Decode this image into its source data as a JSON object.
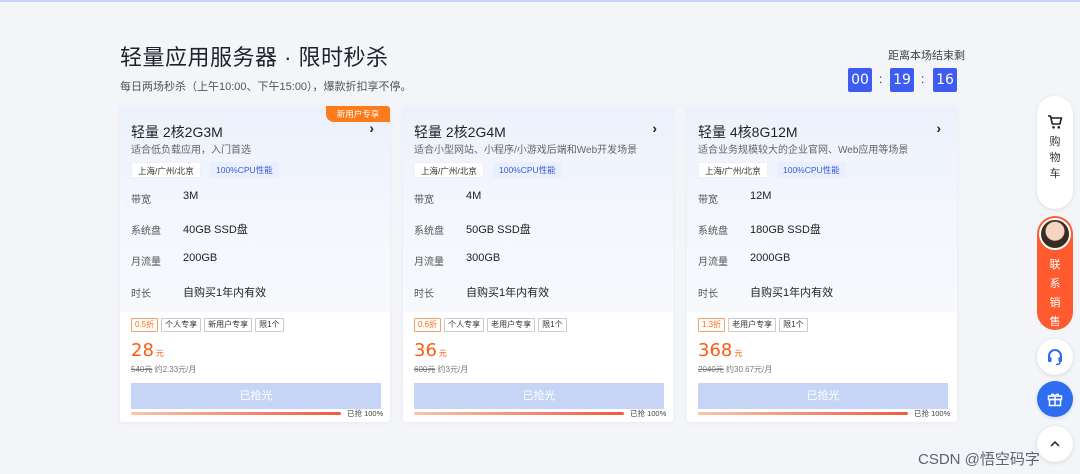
{
  "header": {
    "title": "轻量应用服务器 · 限时秒杀",
    "subtitle": "每日两场秒杀（上午10:00、下午15:00），爆款折扣享不停。"
  },
  "countdown": {
    "label": "距离本场结束剩",
    "hours": "00",
    "minutes": "19",
    "seconds": "16",
    "separator": ":"
  },
  "spec_labels": {
    "bandwidth": "带宽",
    "disk": "系统盘",
    "traffic": "月流量",
    "duration": "时长"
  },
  "cards": [
    {
      "badge": "新用户专享",
      "title": "轻量 2核2G3M",
      "desc": "适合低负载应用，入门首选",
      "region": "上海/广州/北京",
      "cpu_tag": "100%CPU性能",
      "bandwidth": "3M",
      "disk": "40GB SSD盘",
      "traffic": "200GB",
      "duration": "自购买1年内有效",
      "discount": "0.5折",
      "chips": [
        "个人专享",
        "新用户专享",
        "限1个"
      ],
      "price": "28",
      "price_unit": "元",
      "original_price": "540元",
      "monthly": "约2.33元/月",
      "button": "已抢光",
      "progress_text": "已抢 100%",
      "progress": 1.0
    },
    {
      "title": "轻量 2核2G4M",
      "desc": "适合小型网站、小程序/小游戏后端和Web开发场景",
      "region": "上海/广州/北京",
      "cpu_tag": "100%CPU性能",
      "bandwidth": "4M",
      "disk": "50GB SSD盘",
      "traffic": "300GB",
      "duration": "自购买1年内有效",
      "discount": "0.6折",
      "chips": [
        "个人专享",
        "老用户专享",
        "限1个"
      ],
      "price": "36",
      "price_unit": "元",
      "original_price": "600元",
      "monthly": "约3元/月",
      "button": "已抢光",
      "progress_text": "已抢 100%",
      "progress": 1.0
    },
    {
      "title": "轻量 4核8G12M",
      "desc": "适合业务规模较大的企业官网、Web应用等场景",
      "region": "上海/广州/北京",
      "cpu_tag": "100%CPU性能",
      "bandwidth": "12M",
      "disk": "180GB SSD盘",
      "traffic": "2000GB",
      "duration": "自购买1年内有效",
      "discount": "1.3折",
      "chips": [
        "老用户专享",
        "限1个"
      ],
      "price": "368",
      "price_unit": "元",
      "original_price": "2040元",
      "monthly": "约30.67元/月",
      "button": "已抢光",
      "progress_text": "已抢 100%",
      "progress": 1.0
    }
  ],
  "float_bar": {
    "cart": [
      "购",
      "物",
      "车"
    ],
    "sales": [
      "联",
      "系",
      "销",
      "售"
    ]
  },
  "icons": {
    "cart": "cart-icon",
    "headset": "headset-icon",
    "gift": "gift-icon",
    "up": "chevron-up-icon",
    "arrow": "chevron-right-icon"
  },
  "colors": {
    "accent": "#3e5cf0",
    "price": "#ff5a0e",
    "badge": "#ff7a1a",
    "sales": "#ff5b2e",
    "sold_out_button": "#c6d5f6"
  },
  "watermark": "CSDN @悟空码字"
}
